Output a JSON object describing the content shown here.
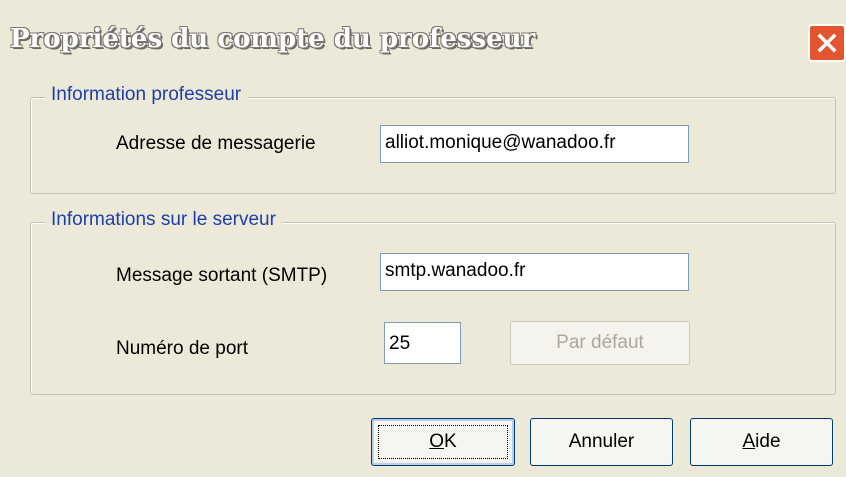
{
  "window": {
    "title": "Propriétés du compte du professeur",
    "close_icon": "close-icon"
  },
  "group_professeur": {
    "legend": "Information professeur",
    "email_label": "Adresse de messagerie",
    "email_value": "alliot.monique@wanadoo.fr"
  },
  "group_serveur": {
    "legend": "Informations sur le serveur",
    "smtp_label": "Message sortant (SMTP)",
    "smtp_value": "smtp.wanadoo.fr",
    "port_label": "Numéro de port",
    "port_value": "25",
    "default_button": "Par défaut"
  },
  "buttons": {
    "ok_mnemonic": "O",
    "ok_rest": "K",
    "cancel": "Annuler",
    "help_mnemonic": "A",
    "help_rest": "ide"
  },
  "colors": {
    "dialog_background": "#ECE9D8",
    "legend_text": "#1E3FA8",
    "close_button": "#E2562F"
  }
}
